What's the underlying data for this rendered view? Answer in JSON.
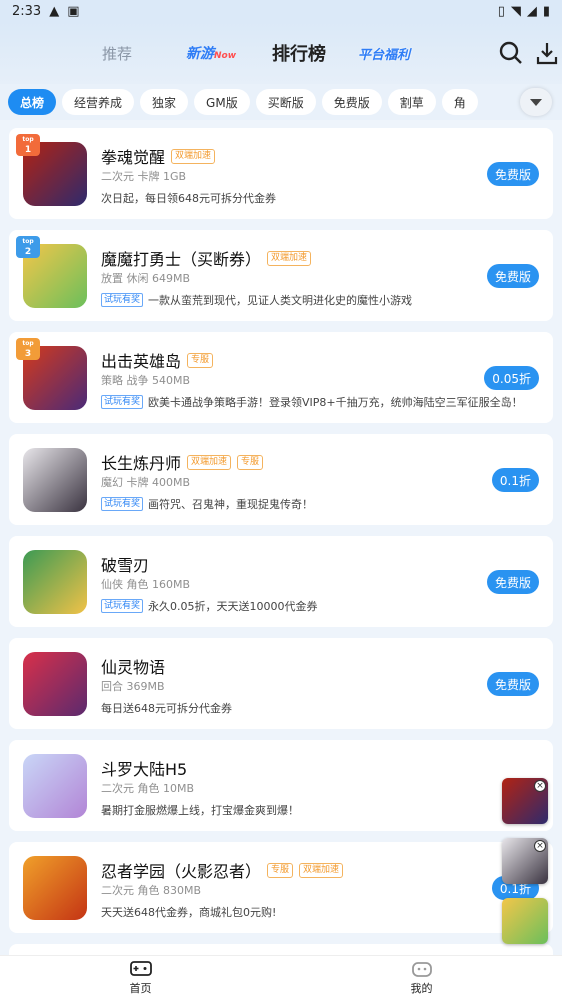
{
  "status_bar": {
    "time": "2:33"
  },
  "header": {
    "tabs": [
      "推荐",
      "新游",
      "排行榜",
      "平台福利"
    ],
    "new_badge": "Now"
  },
  "filters": [
    "总榜",
    "经营养成",
    "独家",
    "GM版",
    "买断版",
    "免费版",
    "割草",
    "角"
  ],
  "games": [
    {
      "rank": "1",
      "name": "拳魂觉醒",
      "tags": [
        "双端加速"
      ],
      "meta": "二次元 卡牌 1GB",
      "trial": "",
      "desc": "次日起，每日领648元可拆分代金券",
      "price": "免费版",
      "colors": [
        "#b22313",
        "#2e2a6d"
      ]
    },
    {
      "rank": "2",
      "name": "魔魔打勇士（买断券）",
      "tags": [
        "双端加速"
      ],
      "meta": "放置 休闲 649MB",
      "trial": "试玩有奖",
      "desc": "一款从蛮荒到现代，见证人类文明进化史的魔性小游戏",
      "price": "免费版",
      "colors": [
        "#f3c64a",
        "#6bbf5b"
      ]
    },
    {
      "rank": "3",
      "name": "出击英雄岛",
      "tags": [
        "专服"
      ],
      "meta": "策略 战争 540MB",
      "trial": "试玩有奖",
      "desc": "欧美卡通战争策略手游！登录领VIP8+千抽万充，统帅海陆空三军征服全岛！",
      "price": "0.05折",
      "colors": [
        "#d43a1c",
        "#4a2a78"
      ]
    },
    {
      "rank": "",
      "name": "长生炼丹师",
      "tags": [
        "双端加速",
        "专服"
      ],
      "meta": "魔幻 卡牌 400MB",
      "trial": "试玩有奖",
      "desc": "画符咒、召鬼神，重现捉鬼传奇！",
      "price": "0.1折",
      "colors": [
        "#e8e6ea",
        "#3a3340"
      ]
    },
    {
      "rank": "",
      "name": "破雪刃",
      "tags": [],
      "meta": "仙侠 角色 160MB",
      "trial": "试玩有奖",
      "desc": "永久0.05折，天天送10000代金券",
      "price": "免费版",
      "colors": [
        "#3c9a54",
        "#f1c248"
      ]
    },
    {
      "rank": "",
      "name": "仙灵物语",
      "tags": [],
      "meta": "回合 369MB",
      "trial": "",
      "desc": "每日送648元可拆分代金券",
      "price": "免费版",
      "colors": [
        "#d8304a",
        "#5b2a6e"
      ]
    },
    {
      "rank": "",
      "name": "斗罗大陆H5",
      "tags": [],
      "meta": "二次元 角色 10MB",
      "trial": "",
      "desc": "暑期打金服燃爆上线，打宝爆金爽到爆！",
      "price": "",
      "colors": [
        "#c9d6f7",
        "#b285d6"
      ]
    },
    {
      "rank": "",
      "name": "忍者学园（火影忍者）",
      "tags": [
        "专服",
        "双端加速"
      ],
      "meta": "二次元 角色 830MB",
      "trial": "",
      "desc": "天天送648代金券，商城礼包0元购!",
      "price": "0.1折",
      "colors": [
        "#f0a02a",
        "#c43414"
      ]
    }
  ],
  "bottom_nav": [
    "首页",
    "我的"
  ],
  "colors": {
    "accent": "#1e8cf2",
    "tag": "#f39a2d"
  }
}
